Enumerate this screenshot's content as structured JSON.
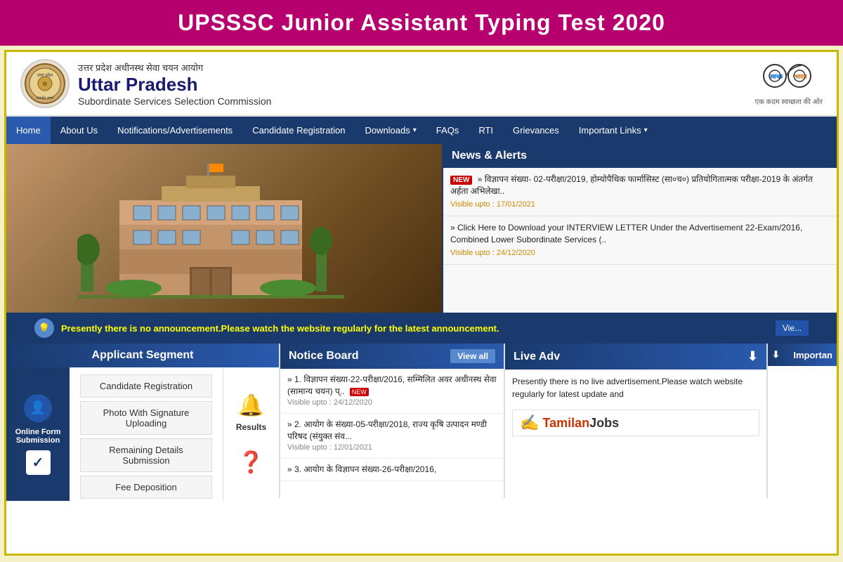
{
  "title_bar": {
    "title": "UPSSSC Junior Assistant Typing Test 2020"
  },
  "header": {
    "hindi_text": "उत्तर प्रदेश अधीनस्थ सेवा चयन आयोग",
    "org_name": "Uttar Pradesh",
    "org_subtitle": "Subordinate Services Selection Commission",
    "swachh_text": "एक कदम स्वच्छता की ओर",
    "swachh_label": "स्वच्छ भारत"
  },
  "nav": {
    "items": [
      {
        "label": "Home",
        "dropdown": false
      },
      {
        "label": "About Us",
        "dropdown": false
      },
      {
        "label": "Notifications/Advertisements",
        "dropdown": false
      },
      {
        "label": "Candidate Registration",
        "dropdown": false
      },
      {
        "label": "Downloads",
        "dropdown": true
      },
      {
        "label": "FAQs",
        "dropdown": false
      },
      {
        "label": "RTI",
        "dropdown": false
      },
      {
        "label": "Grievances",
        "dropdown": false
      },
      {
        "label": "Important Links",
        "dropdown": true
      }
    ]
  },
  "news_alerts": {
    "header": "News & Alerts",
    "items": [
      {
        "is_new": true,
        "text": "» विज्ञापन संख्या- 02-परीक्षा/2019, होम्योपैथिक फार्मासिस्ट (सा०च०) प्रतियोगितात्मक परीक्षा-2019 के अंतर्गत अर्हता अभिलेखा..",
        "visible_upto": "Visible upto : 17/01/2021"
      },
      {
        "is_new": false,
        "text": "» Click Here to Download your INTERVIEW LETTER Under the Advertisement 22-Exam/2016, Combined Lower Subordinate Services (..",
        "visible_upto": "Visible upto : 24/12/2020"
      }
    ]
  },
  "announcement": {
    "text": "Presently there is no announcement.Please watch the website regularly for the latest announcement.",
    "view_label": "Vie..."
  },
  "applicant_segment": {
    "header": "Applicant Segment",
    "online_form_label": "Online Form\nSubmission",
    "links": [
      "Candidate Registration",
      "Photo With Signature Uploading",
      "Remaining Details Submission",
      "Fee Deposition"
    ],
    "results_label": "Results"
  },
  "notice_board": {
    "header": "Notice Board",
    "view_all": "View all",
    "items": [
      {
        "num": "1.",
        "text": "» 1. विज्ञापन संख्या-22-परीक्षा/2016, सम्मिलित अवर अधीनस्थ सेवा (सामान्य चयन) प्...",
        "visible_upto": "Visible upto : 24/12/2020",
        "is_new": true
      },
      {
        "num": "2.",
        "text": "» 2. आयोग के संख्या-05-परीक्षा/2018, राज्य कृषि उत्पादन मण्डी परिषद (संयुक्त संव...",
        "visible_upto": "Visible upto : 12/01/2021",
        "is_new": false
      },
      {
        "num": "3.",
        "text": "» 3. आयोग के विज्ञापन संख्या-26-परीक्षा/2016,",
        "visible_upto": "",
        "is_new": false
      }
    ]
  },
  "live_adv": {
    "header": "Live Adv",
    "text": "Presently there is no live advertisement.Please watch website regularly for latest update and",
    "tamilan_label": "TamilanJobs"
  },
  "important": {
    "header": "Importan"
  }
}
